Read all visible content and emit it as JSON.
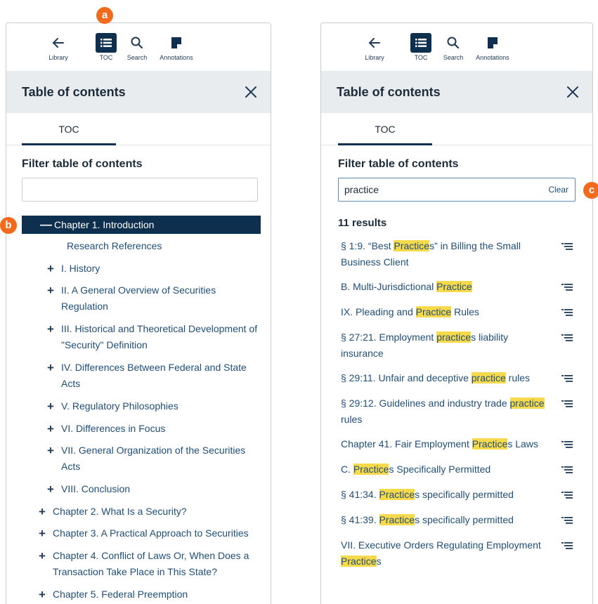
{
  "badges": {
    "a": "a",
    "b": "b",
    "c": "c"
  },
  "toolbar": {
    "library": "Library",
    "toc": "TOC",
    "search": "Search",
    "annotations": "Annotations"
  },
  "header": {
    "title": "Table of contents"
  },
  "tab": {
    "toc": "TOC"
  },
  "filter": {
    "label": "Filter table of contents",
    "left_value": "",
    "right_value": "practice",
    "clear_label": "Clear"
  },
  "toc_items": [
    {
      "sign": "—",
      "text": "Chapter 1. Introduction"
    },
    {
      "sign": "",
      "text": "Research References"
    },
    {
      "sign": "+",
      "text": "I. History"
    },
    {
      "sign": "+",
      "text": "II. A General Overview of Securities Regulation"
    },
    {
      "sign": "+",
      "text": "III. Historical and Theoretical Development of \"Security\" Definition"
    },
    {
      "sign": "+",
      "text": "IV. Differences Between Federal and State Acts"
    },
    {
      "sign": "+",
      "text": "V. Regulatory Philosophies"
    },
    {
      "sign": "+",
      "text": "VI. Differences in Focus"
    },
    {
      "sign": "+",
      "text": "VII. General Organization of the Securities Acts"
    },
    {
      "sign": "+",
      "text": "VIII. Conclusion"
    },
    {
      "sign": "+",
      "text": "Chapter 2. What Is a Security?"
    },
    {
      "sign": "+",
      "text": "Chapter 3. A Practical Approach to Securities"
    },
    {
      "sign": "+",
      "text": "Chapter 4. Conflict of Laws Or, When Does a Transaction Take Place in This State?"
    },
    {
      "sign": "+",
      "text": "Chapter 5. Federal Preemption"
    }
  ],
  "results": {
    "count": "11 results",
    "items": [
      {
        "before": "§ 1:9. “Best ",
        "match": "Practice",
        "after": "s” in Billing the Small Business Client"
      },
      {
        "before": "B. Multi-Jurisdictional ",
        "match": "Practice",
        "after": ""
      },
      {
        "before": "IX. Pleading and ",
        "match": "Practice",
        "after": " Rules"
      },
      {
        "before": "§ 27:21. Employment ",
        "match": "practice",
        "after": "s liability insurance"
      },
      {
        "before": "§ 29:11. Unfair and deceptive ",
        "match": "practice",
        "after": " rules"
      },
      {
        "before": "§ 29:12. Guidelines and industry trade ",
        "match": "practice",
        "after": " rules"
      },
      {
        "before": "Chapter 41. Fair Employment ",
        "match": "Practice",
        "after": "s Laws"
      },
      {
        "before": "C. ",
        "match": "Practice",
        "after": "s Specifically Permitted"
      },
      {
        "before": "§ 41:34. ",
        "match": "Practice",
        "after": "s specifically permitted"
      },
      {
        "before": "§ 41:39. ",
        "match": "Practice",
        "after": "s specifically permitted"
      },
      {
        "before": "VII. Executive Orders Regulating Employment ",
        "match": "Practice",
        "after": "s"
      }
    ]
  },
  "icons": {
    "back": "arrow-left-icon",
    "toc": "list-icon",
    "search": "search-icon",
    "annotations": "note-icon",
    "close": "close-icon",
    "result": "toc-lines-icon"
  },
  "colors": {
    "navy": "#0e2f4d",
    "link": "#1f4e79",
    "highlight": "#f7d94c",
    "badge": "#f26b1d",
    "header_bg": "#e9ecef"
  }
}
